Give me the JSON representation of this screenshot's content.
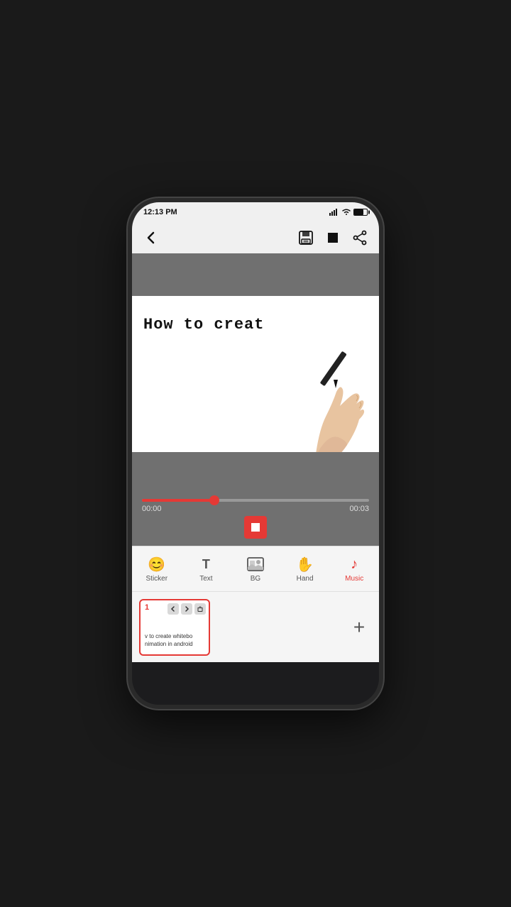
{
  "statusBar": {
    "time": "12:13 PM",
    "batteryPercent": 70,
    "signalBars": 4
  },
  "toolbar": {
    "backLabel": "←",
    "saveLabel": "save",
    "stopLabel": "stop",
    "shareLabel": "share"
  },
  "videoCanvas": {
    "writingText": "How to creat",
    "cursor": "|"
  },
  "timeline": {
    "startTime": "00:00",
    "endTime": "00:03",
    "playedPercent": 32
  },
  "bottomNav": {
    "items": [
      {
        "id": "sticker",
        "label": "Sticker",
        "icon": "😊",
        "active": false
      },
      {
        "id": "text",
        "label": "Text",
        "icon": "T",
        "active": false
      },
      {
        "id": "bg",
        "label": "BG",
        "icon": "bg",
        "active": false
      },
      {
        "id": "hand",
        "label": "Hand",
        "icon": "✋",
        "active": false
      },
      {
        "id": "music",
        "label": "Music",
        "icon": "♪",
        "active": true
      }
    ]
  },
  "clip": {
    "number": "1",
    "textLine1": "v to create whitebo",
    "textLine2": "nimation in android"
  },
  "addButton": {
    "label": "+"
  }
}
